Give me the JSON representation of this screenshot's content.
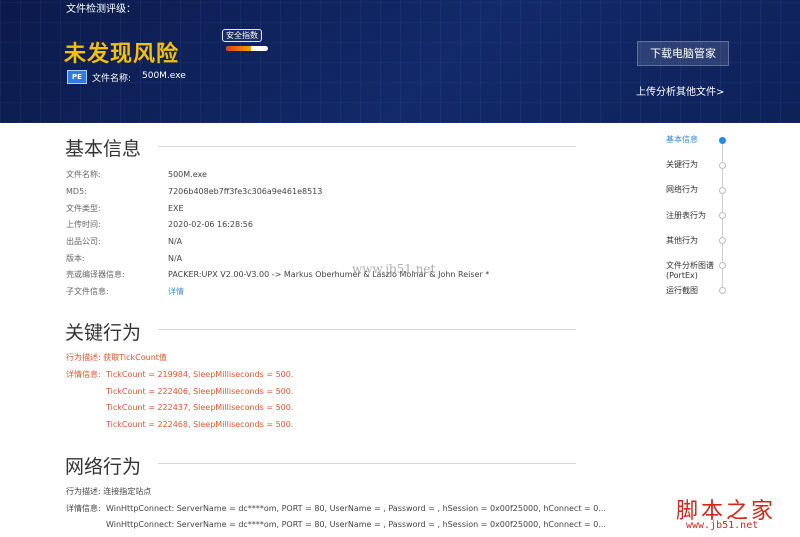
{
  "header": {
    "top_label": "文件检测评级：",
    "result": "未发现风险",
    "safety_badge": "安全指数",
    "safety_level": 0.6,
    "file_icon": "PE",
    "filename_label": "文件名称:",
    "filename": "500M.exe",
    "download_button": "下载电脑管家",
    "upload_link": "上传分析其他文件>"
  },
  "basic_info": {
    "title": "基本信息",
    "rows": [
      {
        "label": "文件名称:",
        "value": "500M.exe"
      },
      {
        "label": "MD5:",
        "value": "7206b408eb7ff3fe3c306a9e461e8513"
      },
      {
        "label": "文件类型:",
        "value": "EXE"
      },
      {
        "label": "上传时间:",
        "value": "2020-02-06 16:28:56"
      },
      {
        "label": "出品公司:",
        "value": "N/A"
      },
      {
        "label": "版本:",
        "value": "N/A"
      },
      {
        "label": "壳或编译器信息:",
        "value": "PACKER:UPX V2.00-V3.00 -> Markus Oberhumer & Laszlo Molnar & John Reiser *"
      },
      {
        "label": "子文件信息:",
        "value": "详情"
      }
    ]
  },
  "key_behavior": {
    "title": "关键行为",
    "desc_label": "行为描述:",
    "desc_value": "获取TickCount值",
    "detail_label": "详情信息:",
    "details": [
      "TickCount = 219984, SleepMilliseconds = 500.",
      "TickCount = 222406, SleepMilliseconds = 500.",
      "TickCount = 222437, SleepMilliseconds = 500.",
      "TickCount = 222468, SleepMilliseconds = 500."
    ]
  },
  "network_behavior": {
    "title": "网络行为",
    "desc_label": "行为描述:",
    "desc_value": "连接指定站点",
    "detail_label": "详情信息:",
    "details": [
      "WinHttpConnect: ServerName = dc****om, PORT = 80, UserName = , Password = , hSession = 0x00f25000, hConnect = 0...",
      "WinHttpConnect: ServerName = dc****om, PORT = 80, UserName = , Password = , hSession = 0x00f25000, hConnect = 0..."
    ]
  },
  "side_nav": {
    "items": [
      {
        "label": "基本信息",
        "active": true
      },
      {
        "label": "关键行为",
        "active": false
      },
      {
        "label": "网络行为",
        "active": false
      },
      {
        "label": "注册表行为",
        "active": false
      },
      {
        "label": "其他行为",
        "active": false
      },
      {
        "label": "文件分析图谱\n(PortEx)",
        "active": false
      },
      {
        "label": "运行截图",
        "active": false
      }
    ]
  },
  "watermarks": {
    "center": "www.jb51.net",
    "logo": "脚本之家",
    "url": "www.jb51.net"
  },
  "colors": {
    "banner": "#12296a",
    "result": "#f5c000",
    "accent": "#2e88e0",
    "warning": "#e8542b"
  }
}
